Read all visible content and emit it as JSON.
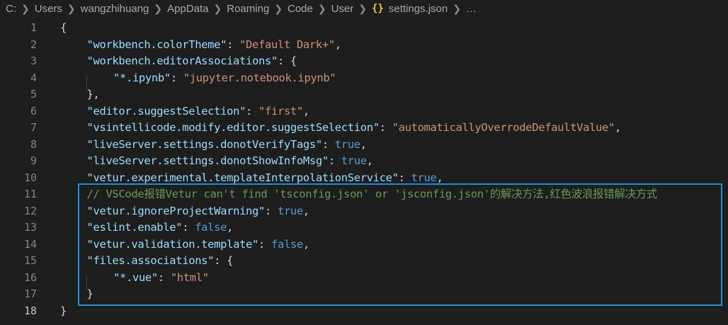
{
  "breadcrumb": {
    "items": [
      "C:",
      "Users",
      "wangzhihuang",
      "AppData",
      "Roaming",
      "Code",
      "User"
    ],
    "file_icon": "{}",
    "file_name": "settings.json",
    "more": "…"
  },
  "colors": {
    "background": "#1e1e1e",
    "key": "#9cdcfe",
    "string": "#ce9178",
    "keyword": "#569cd6",
    "comment": "#6a9955",
    "highlight_border": "#1f8dd6"
  },
  "editor": {
    "active_line": 18,
    "lines": [
      {
        "n": "1",
        "tokens": [
          {
            "t": "punc",
            "v": "{"
          }
        ]
      },
      {
        "n": "2",
        "tokens": [
          {
            "t": "key",
            "v": "\"workbench.colorTheme\""
          },
          {
            "t": "punc",
            "v": ": "
          },
          {
            "t": "str",
            "v": "\"Default Dark+\""
          },
          {
            "t": "punc",
            "v": ","
          }
        ]
      },
      {
        "n": "3",
        "tokens": [
          {
            "t": "key",
            "v": "\"workbench.editorAssociations\""
          },
          {
            "t": "punc",
            "v": ": {"
          }
        ]
      },
      {
        "n": "4",
        "tokens": [
          {
            "t": "key",
            "v": "\"*.ipynb\""
          },
          {
            "t": "punc",
            "v": ": "
          },
          {
            "t": "str",
            "v": "\"jupyter.notebook.ipynb\""
          }
        ]
      },
      {
        "n": "5",
        "tokens": [
          {
            "t": "punc",
            "v": "},"
          }
        ]
      },
      {
        "n": "6",
        "tokens": [
          {
            "t": "key",
            "v": "\"editor.suggestSelection\""
          },
          {
            "t": "punc",
            "v": ": "
          },
          {
            "t": "str",
            "v": "\"first\""
          },
          {
            "t": "punc",
            "v": ","
          }
        ]
      },
      {
        "n": "7",
        "tokens": [
          {
            "t": "key",
            "v": "\"vsintellicode.modify.editor.suggestSelection\""
          },
          {
            "t": "punc",
            "v": ": "
          },
          {
            "t": "str",
            "v": "\"automaticallyOverrodeDefaultValue\""
          },
          {
            "t": "punc",
            "v": ","
          }
        ]
      },
      {
        "n": "8",
        "tokens": [
          {
            "t": "key",
            "v": "\"liveServer.settings.donotVerifyTags\""
          },
          {
            "t": "punc",
            "v": ": "
          },
          {
            "t": "kw",
            "v": "true"
          },
          {
            "t": "punc",
            "v": ","
          }
        ]
      },
      {
        "n": "9",
        "tokens": [
          {
            "t": "key",
            "v": "\"liveServer.settings.donotShowInfoMsg\""
          },
          {
            "t": "punc",
            "v": ": "
          },
          {
            "t": "kw",
            "v": "true"
          },
          {
            "t": "punc",
            "v": ","
          }
        ]
      },
      {
        "n": "10",
        "tokens": [
          {
            "t": "key",
            "v": "\"vetur.experimental.templateInterpolationService\""
          },
          {
            "t": "punc",
            "v": ": "
          },
          {
            "t": "kw",
            "v": "true"
          },
          {
            "t": "punc",
            "v": ","
          }
        ]
      },
      {
        "n": "11",
        "tokens": [
          {
            "t": "cmt",
            "v": "// VSCode报错Vetur can't find 'tsconfig.json' or 'jsconfig.json'的解决方法,红色波浪报错解决方式"
          }
        ]
      },
      {
        "n": "12",
        "tokens": [
          {
            "t": "key",
            "v": "\"vetur.ignoreProjectWarning\""
          },
          {
            "t": "punc",
            "v": ": "
          },
          {
            "t": "kw",
            "v": "true"
          },
          {
            "t": "punc",
            "v": ","
          }
        ]
      },
      {
        "n": "13",
        "tokens": [
          {
            "t": "key",
            "v": "\"eslint.enable\""
          },
          {
            "t": "punc",
            "v": ": "
          },
          {
            "t": "kw",
            "v": "false"
          },
          {
            "t": "punc",
            "v": ","
          }
        ]
      },
      {
        "n": "14",
        "tokens": [
          {
            "t": "key",
            "v": "\"vetur.validation.template\""
          },
          {
            "t": "punc",
            "v": ": "
          },
          {
            "t": "kw",
            "v": "false"
          },
          {
            "t": "punc",
            "v": ","
          }
        ]
      },
      {
        "n": "15",
        "tokens": [
          {
            "t": "key",
            "v": "\"files.associations\""
          },
          {
            "t": "punc",
            "v": ": {"
          }
        ]
      },
      {
        "n": "16",
        "tokens": [
          {
            "t": "key",
            "v": "\"*.vue\""
          },
          {
            "t": "punc",
            "v": ": "
          },
          {
            "t": "str",
            "v": "\"html\""
          }
        ]
      },
      {
        "n": "17",
        "tokens": [
          {
            "t": "punc",
            "v": "}"
          }
        ]
      },
      {
        "n": "18",
        "tokens": [
          {
            "t": "punc",
            "v": "}"
          }
        ]
      }
    ]
  }
}
